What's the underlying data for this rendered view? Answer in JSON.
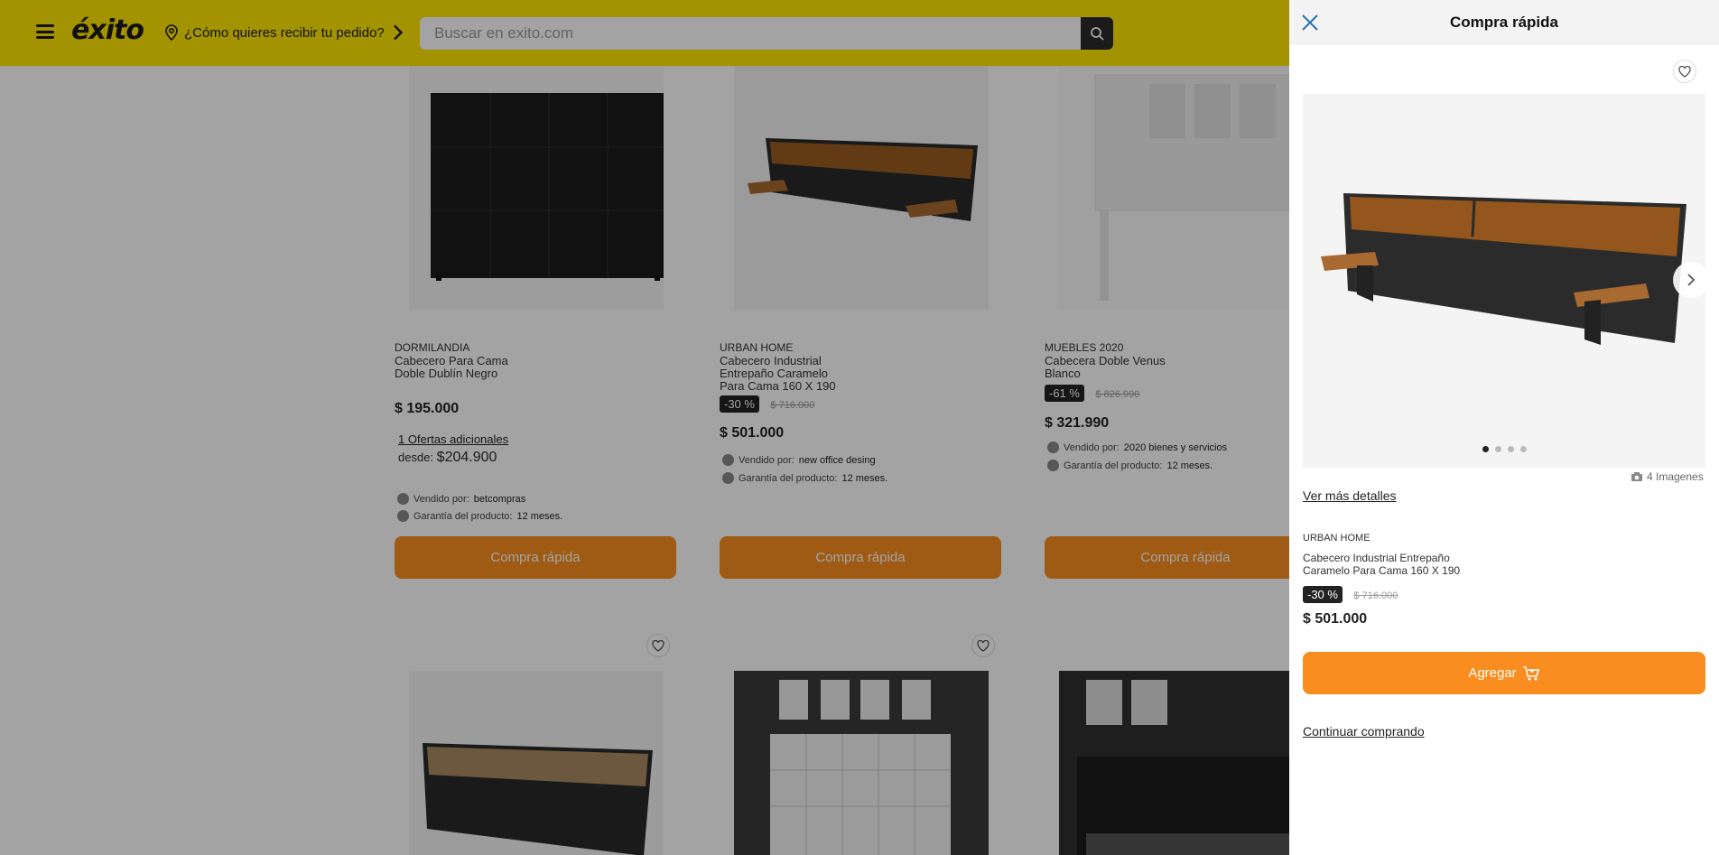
{
  "header": {
    "logo": "éxito",
    "delivery_prompt": "¿Cómo quieres recibir tu pedido?",
    "search_placeholder": "Buscar en exito.com",
    "brand_color": "#ffe600"
  },
  "products": [
    {
      "brand": "DORMILANDIA",
      "name": "Cabecero Para Cama Doble Dublín Negro",
      "price": "$ 195.000",
      "offers": "1 Ofertas adicionales",
      "from_label": "desde:",
      "from_price": "$204.900",
      "sold_by_label": "Vendido por:",
      "sold_by": "betcompras",
      "warranty_label": "Garantía del producto:",
      "warranty": "12 meses.",
      "cta": "Compra rápida"
    },
    {
      "brand": "URBAN HOME",
      "name": "Cabecero Industrial Entrepaño Caramelo Para Cama 160 X 190",
      "discount": "-30 %",
      "old_price": "$ 716.000",
      "price": "$ 501.000",
      "sold_by_label": "Vendido por:",
      "sold_by": "new office desing",
      "warranty_label": "Garantía del producto:",
      "warranty": "12 meses.",
      "cta": "Compra rápida"
    },
    {
      "brand": "MUEBLES 2020",
      "name": "Cabecera Doble Venus Blanco",
      "discount": "-61 %",
      "old_price": "$ 826.990",
      "price": "$ 321.990",
      "sold_by_label": "Vendido por:",
      "sold_by": "2020 bienes y servicios",
      "warranty_label": "Garantía del producto:",
      "warranty": "12 meses.",
      "cta": "Compra rápida"
    }
  ],
  "quick_buy": {
    "title": "Compra rápida",
    "image_count": "4 Imagenes",
    "see_details": "Ver más detalles",
    "brand": "URBAN HOME",
    "name": "Cabecero Industrial Entrepaño Caramelo Para Cama 160 X 190",
    "discount": "-30 %",
    "old_price": "$ 716.000",
    "price": "$ 501.000",
    "add_button": "Agregar",
    "continue": "Continuar comprando",
    "accent_color": "#f98d1f"
  }
}
